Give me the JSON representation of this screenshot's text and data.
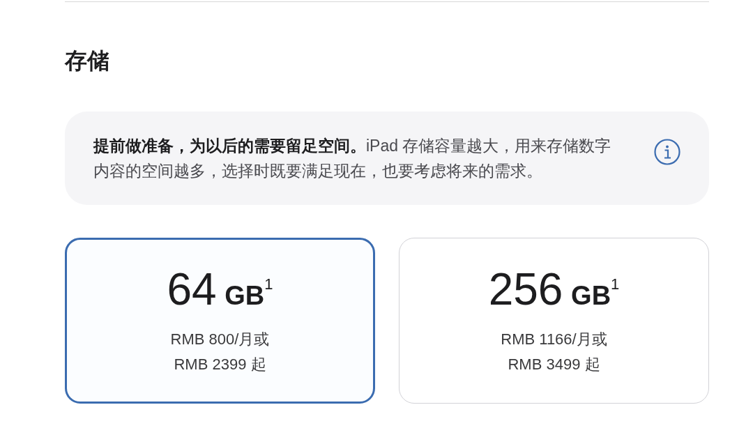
{
  "section": {
    "title": "存储"
  },
  "info_panel": {
    "text": "**提前做准备，为以后的需要留足空间。**iPad 存储容量越大，用来存储数字内容的空间越多，选择时既要满足现在，也要考虑将来的需求。"
  },
  "options": [
    {
      "capacity": "64",
      "unit": "GB",
      "footnote": "1",
      "price_lines": [
        "RMB 800/月或",
        "RMB 2399 起"
      ],
      "selected": true
    },
    {
      "capacity": "256",
      "unit": "GB",
      "footnote": "1",
      "price_lines": [
        "RMB 1166/月或",
        "RMB 3499 起"
      ],
      "selected": false
    }
  ]
}
